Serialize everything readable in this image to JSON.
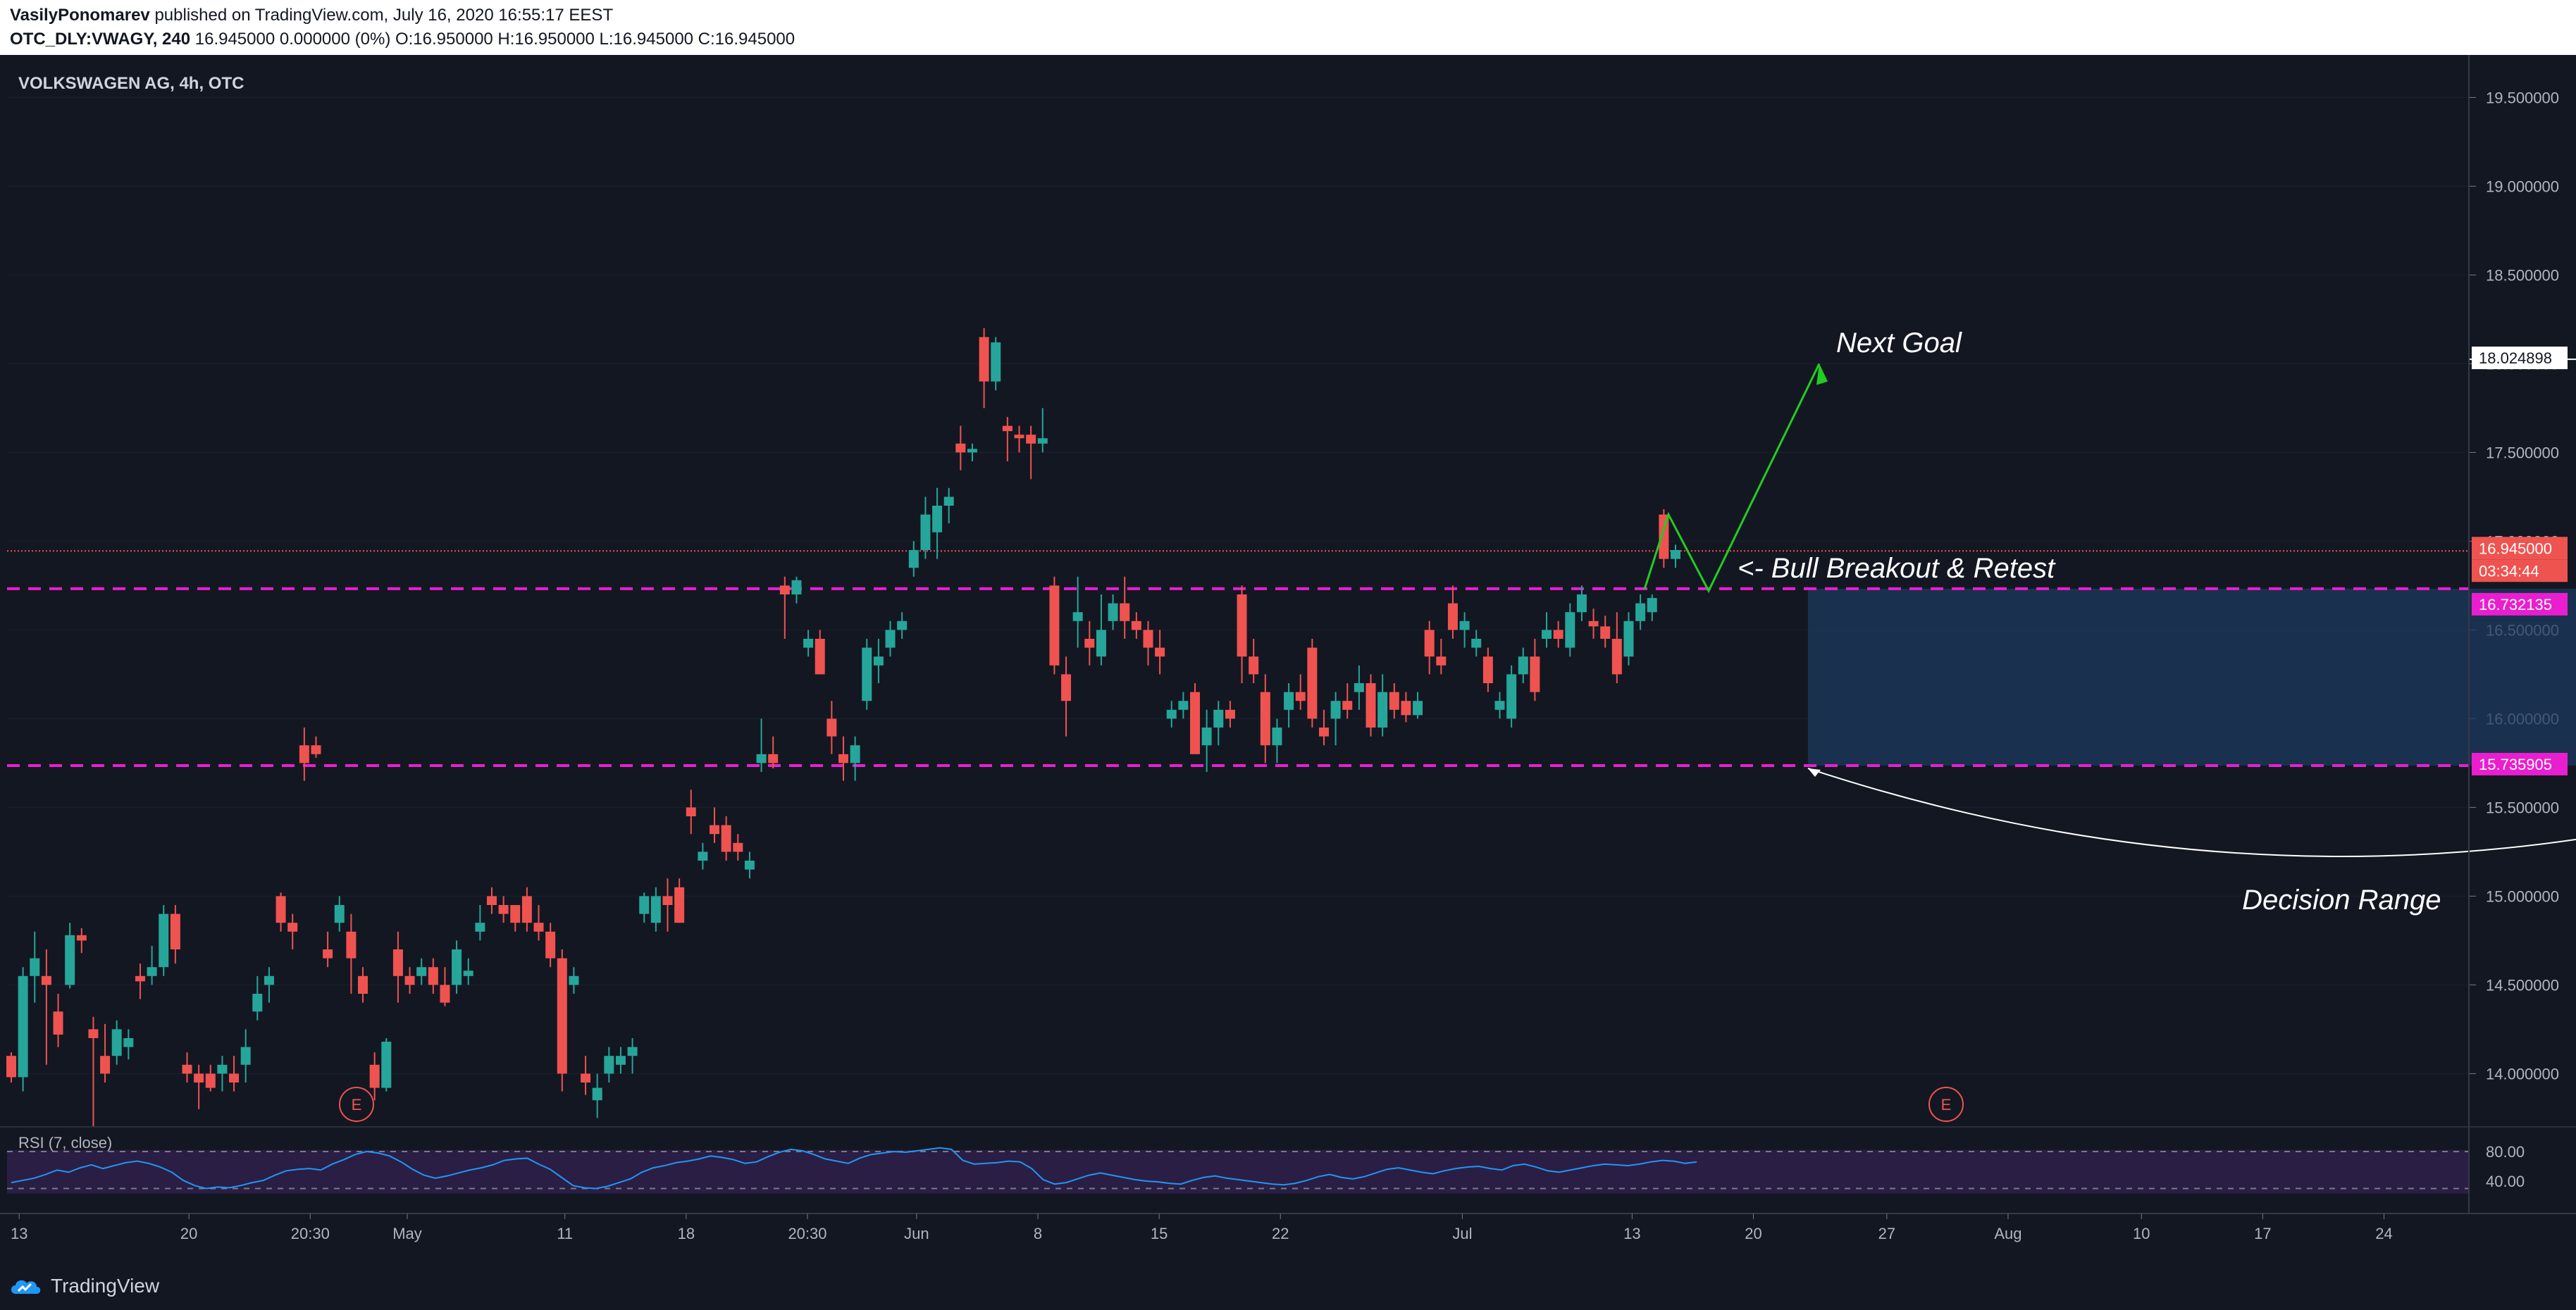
{
  "header": {
    "author": "VasilyPonomarev",
    "published_text": "published on TradingView.com, July 16, 2020 16:55:17 EEST",
    "symbol_line_bold": "OTC_DLY:VWAGY, 240",
    "symbol_line_rest": " 16.945000 0.000000 (0%) O:16.950000 H:16.950000 L:16.945000 C:16.945000"
  },
  "chart_data": {
    "type": "candlestick",
    "title": "VOLKSWAGEN AG, 4h, OTC",
    "y_range": [
      13.7,
      19.7
    ],
    "y_ticks": [
      "19.500000",
      "19.000000",
      "18.500000",
      "18.000000",
      "17.500000",
      "17.000000",
      "16.500000",
      "16.000000",
      "15.500000",
      "15.000000",
      "14.500000",
      "14.000000"
    ],
    "y_tick_values": [
      19.5,
      19.0,
      18.5,
      18.0,
      17.5,
      17.0,
      16.5,
      16.0,
      15.5,
      15.0,
      14.5,
      14.0
    ],
    "x_labels": [
      "13",
      "20",
      "20:30",
      "May",
      "11",
      "18",
      "20:30",
      "Jun",
      "8",
      "15",
      "22",
      "Jul",
      "13",
      "20",
      "27",
      "Aug",
      "10",
      "17",
      "24"
    ],
    "x_label_slots": [
      1,
      15,
      25,
      33,
      46,
      56,
      66,
      75,
      85,
      95,
      105,
      120,
      134,
      144,
      155,
      165,
      176,
      186,
      196
    ],
    "x_slot_count": 203,
    "candles": [
      [
        14.1,
        14.12,
        13.95,
        13.98
      ],
      [
        13.98,
        14.6,
        13.9,
        14.55
      ],
      [
        14.55,
        14.8,
        14.4,
        14.65
      ],
      [
        14.55,
        14.7,
        14.05,
        14.5
      ],
      [
        14.35,
        14.45,
        14.15,
        14.22
      ],
      [
        14.5,
        14.85,
        14.48,
        14.78
      ],
      [
        14.78,
        14.82,
        14.68,
        14.75
      ],
      [
        14.25,
        14.32,
        13.7,
        14.2
      ],
      [
        14.1,
        14.28,
        13.95,
        14.0
      ],
      [
        14.1,
        14.3,
        14.05,
        14.25
      ],
      [
        14.15,
        14.25,
        14.08,
        14.2
      ],
      [
        14.55,
        14.62,
        14.42,
        14.52
      ],
      [
        14.55,
        14.72,
        14.5,
        14.6
      ],
      [
        14.6,
        14.95,
        14.55,
        14.9
      ],
      [
        14.9,
        14.95,
        14.62,
        14.7
      ],
      [
        14.05,
        14.12,
        13.95,
        14.0
      ],
      [
        14.0,
        14.05,
        13.8,
        13.95
      ],
      [
        14.0,
        14.05,
        13.9,
        13.92
      ],
      [
        14.0,
        14.1,
        13.9,
        14.05
      ],
      [
        14.0,
        14.1,
        13.9,
        13.95
      ],
      [
        14.05,
        14.25,
        13.95,
        14.15
      ],
      [
        14.35,
        14.55,
        14.3,
        14.45
      ],
      [
        14.5,
        14.6,
        14.4,
        14.55
      ],
      [
        15.0,
        15.02,
        14.8,
        14.85
      ],
      [
        14.85,
        14.9,
        14.7,
        14.8
      ],
      [
        15.85,
        15.95,
        15.65,
        15.75
      ],
      [
        15.85,
        15.9,
        15.78,
        15.8
      ],
      [
        14.7,
        14.8,
        14.6,
        14.65
      ],
      [
        14.85,
        15.0,
        14.8,
        14.95
      ],
      [
        14.8,
        14.9,
        14.45,
        14.65
      ],
      [
        14.55,
        14.6,
        14.4,
        14.45
      ],
      [
        14.05,
        14.12,
        13.85,
        13.92
      ],
      [
        13.92,
        14.2,
        13.9,
        14.18
      ],
      [
        14.7,
        14.8,
        14.4,
        14.55
      ],
      [
        14.55,
        14.6,
        14.45,
        14.5
      ],
      [
        14.55,
        14.65,
        14.5,
        14.6
      ],
      [
        14.6,
        14.65,
        14.45,
        14.5
      ],
      [
        14.5,
        14.6,
        14.38,
        14.4
      ],
      [
        14.5,
        14.75,
        14.45,
        14.7
      ],
      [
        14.55,
        14.65,
        14.5,
        14.58
      ],
      [
        14.8,
        14.95,
        14.75,
        14.85
      ],
      [
        15.0,
        15.05,
        14.9,
        14.95
      ],
      [
        14.95,
        15.0,
        14.85,
        14.9
      ],
      [
        14.95,
        14.95,
        14.8,
        14.85
      ],
      [
        15.0,
        15.05,
        14.8,
        14.85
      ],
      [
        14.85,
        14.95,
        14.75,
        14.8
      ],
      [
        14.8,
        14.85,
        14.6,
        14.65
      ],
      [
        14.65,
        14.7,
        13.9,
        14.0
      ],
      [
        14.5,
        14.6,
        14.45,
        14.55
      ],
      [
        14.0,
        14.1,
        13.88,
        13.95
      ],
      [
        13.85,
        14.0,
        13.75,
        13.92
      ],
      [
        14.0,
        14.15,
        13.95,
        14.1
      ],
      [
        14.05,
        14.15,
        14.0,
        14.1
      ],
      [
        14.1,
        14.2,
        14.0,
        14.15
      ],
      [
        14.9,
        15.02,
        14.85,
        15.0
      ],
      [
        14.85,
        15.05,
        14.8,
        15.0
      ],
      [
        15.0,
        15.1,
        14.8,
        14.95
      ],
      [
        15.05,
        15.1,
        14.85,
        14.85
      ],
      [
        15.5,
        15.6,
        15.35,
        15.45
      ],
      [
        15.2,
        15.3,
        15.15,
        15.25
      ],
      [
        15.4,
        15.5,
        15.3,
        15.35
      ],
      [
        15.4,
        15.45,
        15.2,
        15.25
      ],
      [
        15.3,
        15.35,
        15.2,
        15.25
      ],
      [
        15.15,
        15.25,
        15.1,
        15.2
      ],
      [
        15.75,
        16.0,
        15.7,
        15.8
      ],
      [
        15.8,
        15.9,
        15.72,
        15.75
      ],
      [
        16.75,
        16.8,
        16.45,
        16.7
      ],
      [
        16.7,
        16.8,
        16.65,
        16.78
      ],
      [
        16.4,
        16.5,
        16.35,
        16.45
      ],
      [
        16.45,
        16.5,
        16.3,
        16.25
      ],
      [
        16.0,
        16.1,
        15.8,
        15.9
      ],
      [
        15.8,
        15.9,
        15.65,
        15.75
      ],
      [
        15.75,
        15.9,
        15.65,
        15.85
      ],
      [
        16.1,
        16.45,
        16.05,
        16.4
      ],
      [
        16.3,
        16.45,
        16.2,
        16.35
      ],
      [
        16.4,
        16.55,
        16.35,
        16.5
      ],
      [
        16.5,
        16.6,
        16.45,
        16.55
      ],
      [
        16.85,
        17.0,
        16.8,
        16.95
      ],
      [
        16.95,
        17.25,
        16.9,
        17.15
      ],
      [
        17.05,
        17.3,
        16.9,
        17.2
      ],
      [
        17.2,
        17.3,
        17.1,
        17.25
      ],
      [
        17.55,
        17.65,
        17.4,
        17.5
      ],
      [
        17.5,
        17.55,
        17.45,
        17.52
      ],
      [
        18.15,
        18.2,
        17.75,
        17.9
      ],
      [
        17.9,
        18.15,
        17.85,
        18.12
      ],
      [
        17.65,
        17.7,
        17.45,
        17.62
      ],
      [
        17.6,
        17.65,
        17.5,
        17.58
      ],
      [
        17.6,
        17.65,
        17.35,
        17.55
      ],
      [
        17.55,
        17.75,
        17.5,
        17.58
      ],
      [
        16.75,
        16.8,
        16.25,
        16.3
      ],
      [
        16.25,
        16.35,
        15.9,
        16.1
      ],
      [
        16.55,
        16.8,
        16.4,
        16.6
      ],
      [
        16.45,
        16.55,
        16.3,
        16.4
      ],
      [
        16.35,
        16.7,
        16.3,
        16.5
      ],
      [
        16.55,
        16.7,
        16.5,
        16.65
      ],
      [
        16.65,
        16.8,
        16.45,
        16.55
      ],
      [
        16.55,
        16.6,
        16.45,
        16.5
      ],
      [
        16.5,
        16.55,
        16.3,
        16.4
      ],
      [
        16.4,
        16.5,
        16.25,
        16.35
      ],
      [
        16.0,
        16.1,
        15.95,
        16.05
      ],
      [
        16.05,
        16.15,
        16.0,
        16.1
      ],
      [
        16.15,
        16.2,
        15.85,
        15.8
      ],
      [
        15.85,
        16.05,
        15.7,
        15.95
      ],
      [
        15.95,
        16.1,
        15.85,
        16.05
      ],
      [
        16.05,
        16.1,
        15.95,
        16.0
      ],
      [
        16.7,
        16.75,
        16.2,
        16.35
      ],
      [
        16.35,
        16.45,
        16.2,
        16.25
      ],
      [
        16.15,
        16.25,
        15.75,
        15.85
      ],
      [
        15.85,
        16.0,
        15.75,
        15.95
      ],
      [
        16.05,
        16.2,
        15.95,
        16.15
      ],
      [
        16.15,
        16.25,
        16.05,
        16.1
      ],
      [
        16.4,
        16.45,
        15.95,
        16.0
      ],
      [
        15.95,
        16.05,
        15.85,
        15.9
      ],
      [
        16.0,
        16.15,
        15.85,
        16.1
      ],
      [
        16.1,
        16.2,
        16.0,
        16.05
      ],
      [
        16.15,
        16.3,
        16.05,
        16.2
      ],
      [
        16.2,
        16.25,
        15.9,
        15.95
      ],
      [
        15.95,
        16.25,
        15.9,
        16.15
      ],
      [
        16.15,
        16.2,
        16.0,
        16.05
      ],
      [
        16.1,
        16.15,
        15.98,
        16.02
      ],
      [
        16.02,
        16.15,
        16.0,
        16.1
      ],
      [
        16.5,
        16.55,
        16.25,
        16.35
      ],
      [
        16.35,
        16.45,
        16.25,
        16.3
      ],
      [
        16.65,
        16.75,
        16.45,
        16.5
      ],
      [
        16.5,
        16.6,
        16.4,
        16.55
      ],
      [
        16.4,
        16.5,
        16.35,
        16.45
      ],
      [
        16.35,
        16.4,
        16.15,
        16.2
      ],
      [
        16.05,
        16.15,
        16.0,
        16.1
      ],
      [
        16.0,
        16.3,
        15.95,
        16.25
      ],
      [
        16.25,
        16.4,
        16.2,
        16.35
      ],
      [
        16.35,
        16.45,
        16.1,
        16.15
      ],
      [
        16.45,
        16.6,
        16.4,
        16.5
      ],
      [
        16.5,
        16.55,
        16.4,
        16.45
      ],
      [
        16.4,
        16.65,
        16.35,
        16.6
      ],
      [
        16.6,
        16.75,
        16.55,
        16.7
      ],
      [
        16.55,
        16.62,
        16.45,
        16.52
      ],
      [
        16.52,
        16.58,
        16.4,
        16.45
      ],
      [
        16.45,
        16.6,
        16.2,
        16.25
      ],
      [
        16.35,
        16.6,
        16.3,
        16.55
      ],
      [
        16.55,
        16.7,
        16.5,
        16.65
      ],
      [
        16.6,
        16.7,
        16.55,
        16.68
      ],
      [
        17.15,
        17.18,
        16.85,
        16.9
      ],
      [
        16.9,
        16.98,
        16.85,
        16.95
      ]
    ],
    "horizontal_levels": {
      "upper": 16.732135,
      "lower": 15.735905,
      "current": 16.945,
      "target": 18.024898
    },
    "price_labels": [
      "16.945000",
      "03:34:44",
      "16.732135",
      "15.735905",
      "18.024898"
    ],
    "annotations": {
      "next_goal": "Next Goal",
      "breakout": "<- Bull Breakout & Retest",
      "range": "Decision Range",
      "earnings_marker": "E"
    },
    "rsi": {
      "label": "RSI (7, close)",
      "ticks": [
        "80.00",
        "40.00"
      ],
      "tick_values": [
        80,
        40
      ],
      "values": [
        38,
        41,
        44,
        49,
        55,
        52,
        58,
        62,
        57,
        61,
        65,
        67,
        64,
        59,
        52,
        41,
        34,
        30,
        32,
        31,
        34,
        38,
        41,
        48,
        54,
        56,
        57,
        55,
        63,
        69,
        76,
        80,
        78,
        74,
        66,
        56,
        48,
        44,
        47,
        51,
        55,
        58,
        62,
        68,
        70,
        71,
        63,
        56,
        45,
        34,
        31,
        30,
        33,
        38,
        43,
        52,
        58,
        61,
        65,
        67,
        70,
        74,
        72,
        69,
        64,
        66,
        73,
        79,
        83,
        81,
        76,
        70,
        67,
        64,
        71,
        76,
        78,
        80,
        79,
        81,
        83,
        85,
        83,
        68,
        63,
        64,
        65,
        67,
        66,
        57,
        42,
        36,
        38,
        43,
        48,
        51,
        48,
        45,
        42,
        40,
        39,
        37,
        36,
        41,
        45,
        47,
        44,
        42,
        40,
        38,
        36,
        35,
        37,
        41,
        46,
        49,
        45,
        43,
        46,
        51,
        56,
        58,
        55,
        52,
        50,
        54,
        57,
        59,
        60,
        57,
        55,
        61,
        63,
        59,
        54,
        52,
        55,
        58,
        61,
        63,
        62,
        61,
        63,
        66,
        68,
        67,
        64,
        66
      ]
    },
    "colors": {
      "up": "#26a69a",
      "down": "#ef5350",
      "level": "#e91ecf",
      "current_line": "#ef5350",
      "range_box": "#1e3a5f",
      "arrow": "#22cc22",
      "rsi_line": "#2196f3",
      "rsi_band": "#2a1e45"
    }
  },
  "footer": {
    "brand": "TradingView"
  }
}
